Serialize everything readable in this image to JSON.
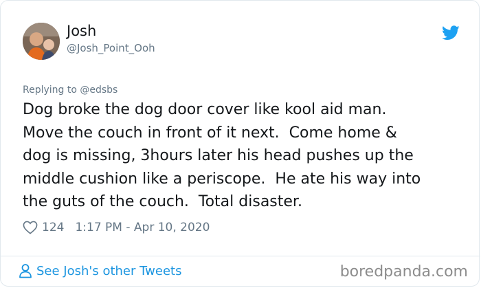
{
  "tweet": {
    "author_name": "Josh",
    "author_handle": "@Josh_Point_Ooh",
    "replying_to": "Replying to @edsbs",
    "text": "Dog broke the dog door cover like kool aid man.\nMove the couch in front of it next.  Come home &\ndog is missing, 3hours later his head pushes up the\nmiddle cushion like a periscope.  He ate his way into\nthe guts of the couch.  Total disaster.",
    "like_count": "124",
    "timestamp": "1:17 PM - Apr 10, 2020",
    "see_more_label": "See Josh's other Tweets"
  },
  "watermark": "boredpanda.com",
  "icons": {
    "bird": "twitter-bird-icon",
    "heart": "heart-icon",
    "person": "person-icon"
  },
  "colors": {
    "twitter_blue": "#1da1f2",
    "link_blue": "#1b95e0",
    "secondary_text": "#657786",
    "primary_text": "#14171a"
  }
}
